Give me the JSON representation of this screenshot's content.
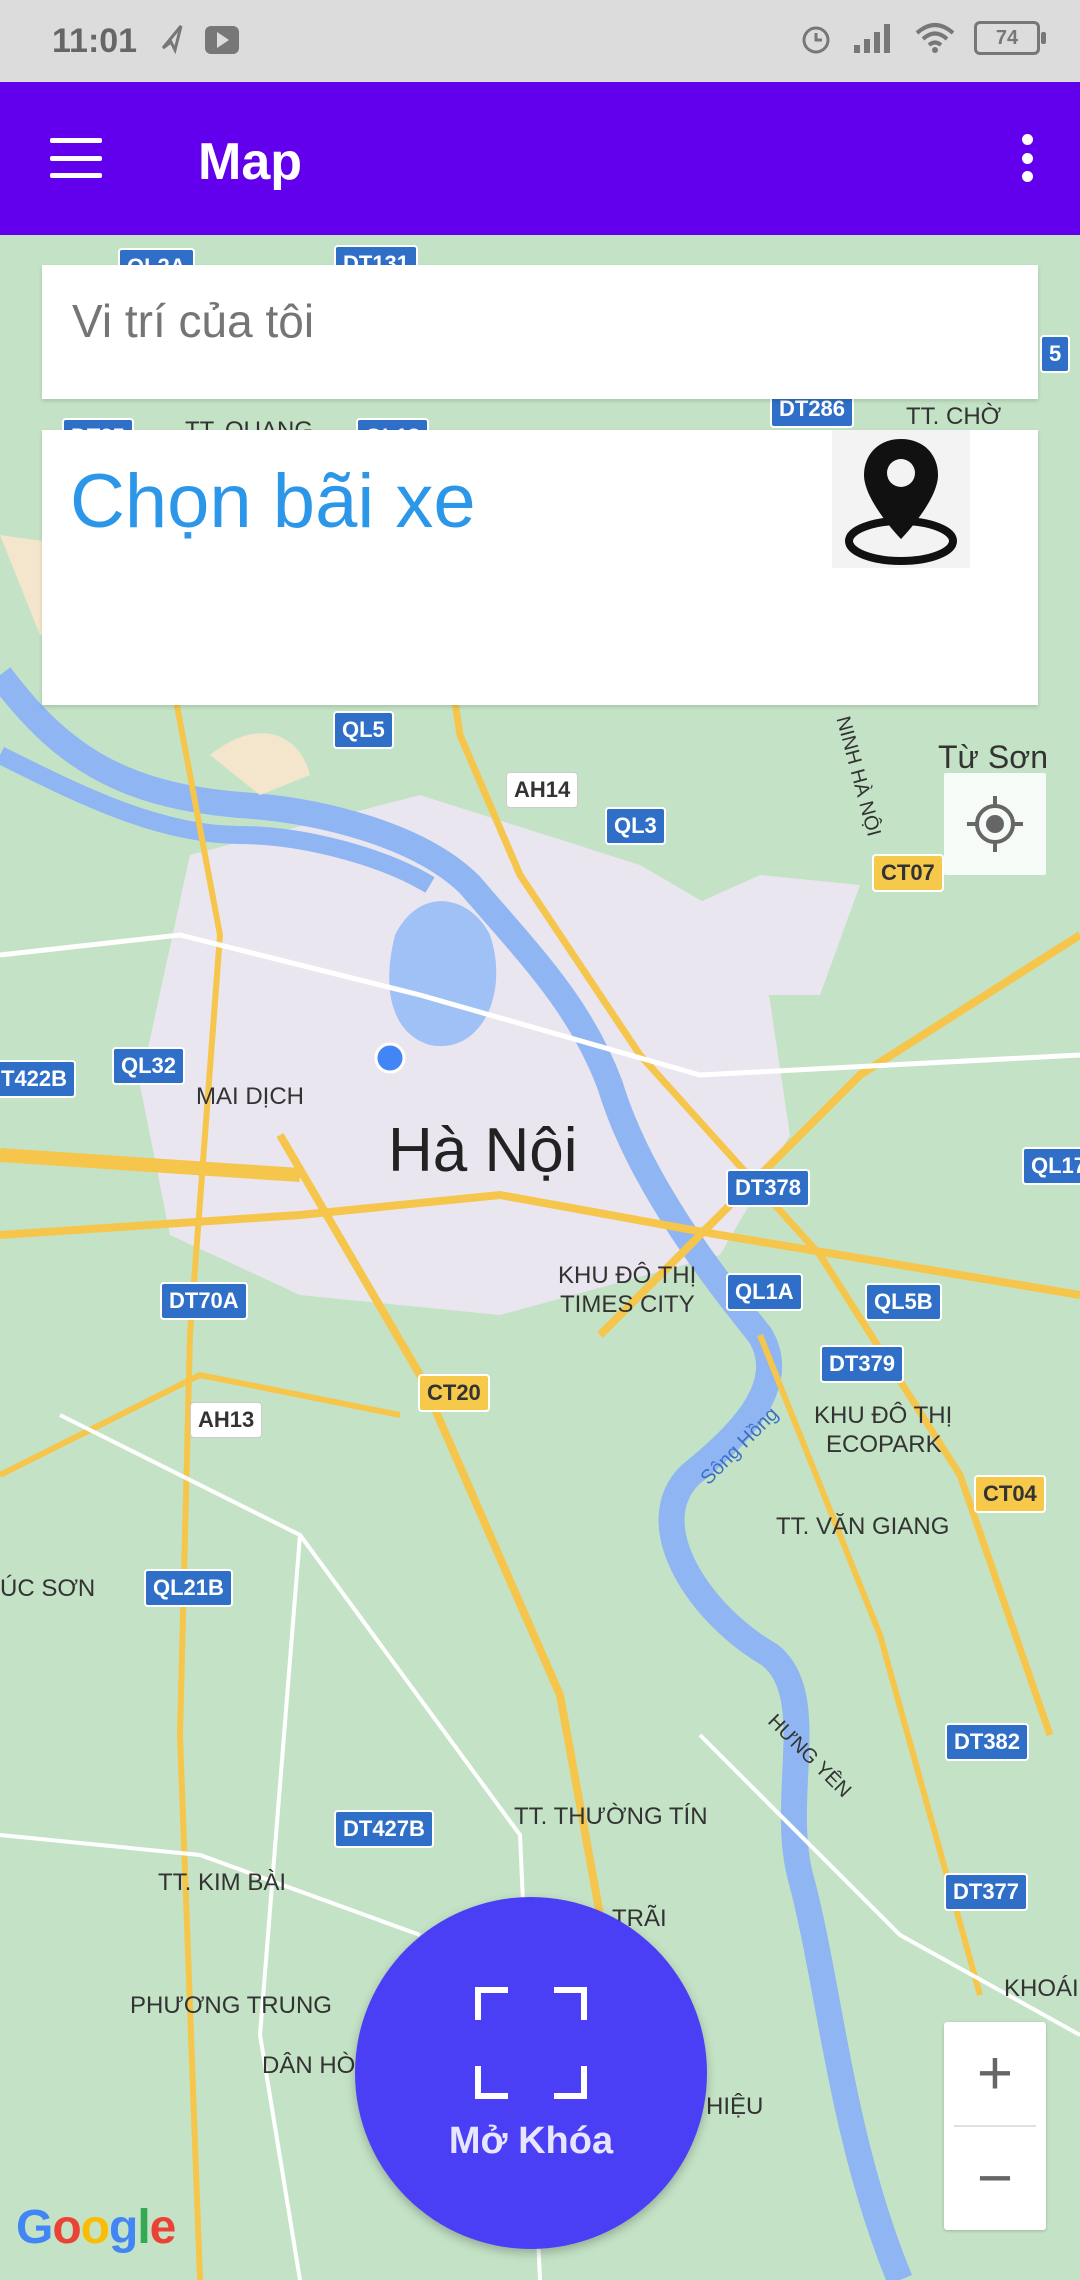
{
  "status_bar": {
    "time": "11:01",
    "battery": "74"
  },
  "app_bar": {
    "title": "Map"
  },
  "search": {
    "placeholder": "Vi trí của tôi"
  },
  "parking_card": {
    "title": "Chọn bãi xe"
  },
  "map": {
    "city": "Hà Nội",
    "place_labels": [
      "TT. QUANG",
      "TT. CHỜ",
      "Từ Sơn",
      "MAI DỊCH",
      "KHU ĐÔ THỊ",
      "TIMES CITY",
      "KHU ĐÔ THỊ",
      "ECOPARK",
      "TT. VĂN GIANG",
      "ÚC SƠN",
      "Sông Hồng",
      "HƯNG YÊN",
      "TT. THƯỜNG TÍN",
      "TT. KIM BÀI",
      "PHƯƠNG TRUNG",
      "DÂN HÒ",
      "KHOÁI",
      "HIỆU",
      "TRÃI",
      "NINH HÀ NỘI"
    ],
    "road_badges": [
      "QL2A",
      "DT131",
      "5",
      "DT35",
      "QL18",
      "DT286",
      "QL5",
      "AH14",
      "QL3",
      "CT07",
      "T422B",
      "QL32",
      "QL17",
      "DT378",
      "DT70A",
      "QL1A",
      "QL5B",
      "DT379",
      "CT20",
      "AH13",
      "CT04",
      "QL21B",
      "DT382",
      "DT427B",
      "DT377"
    ],
    "attribution": "Google"
  },
  "controls": {
    "zoom_in": "+",
    "zoom_out": "−"
  },
  "fab": {
    "label": "Mở Khóa"
  }
}
